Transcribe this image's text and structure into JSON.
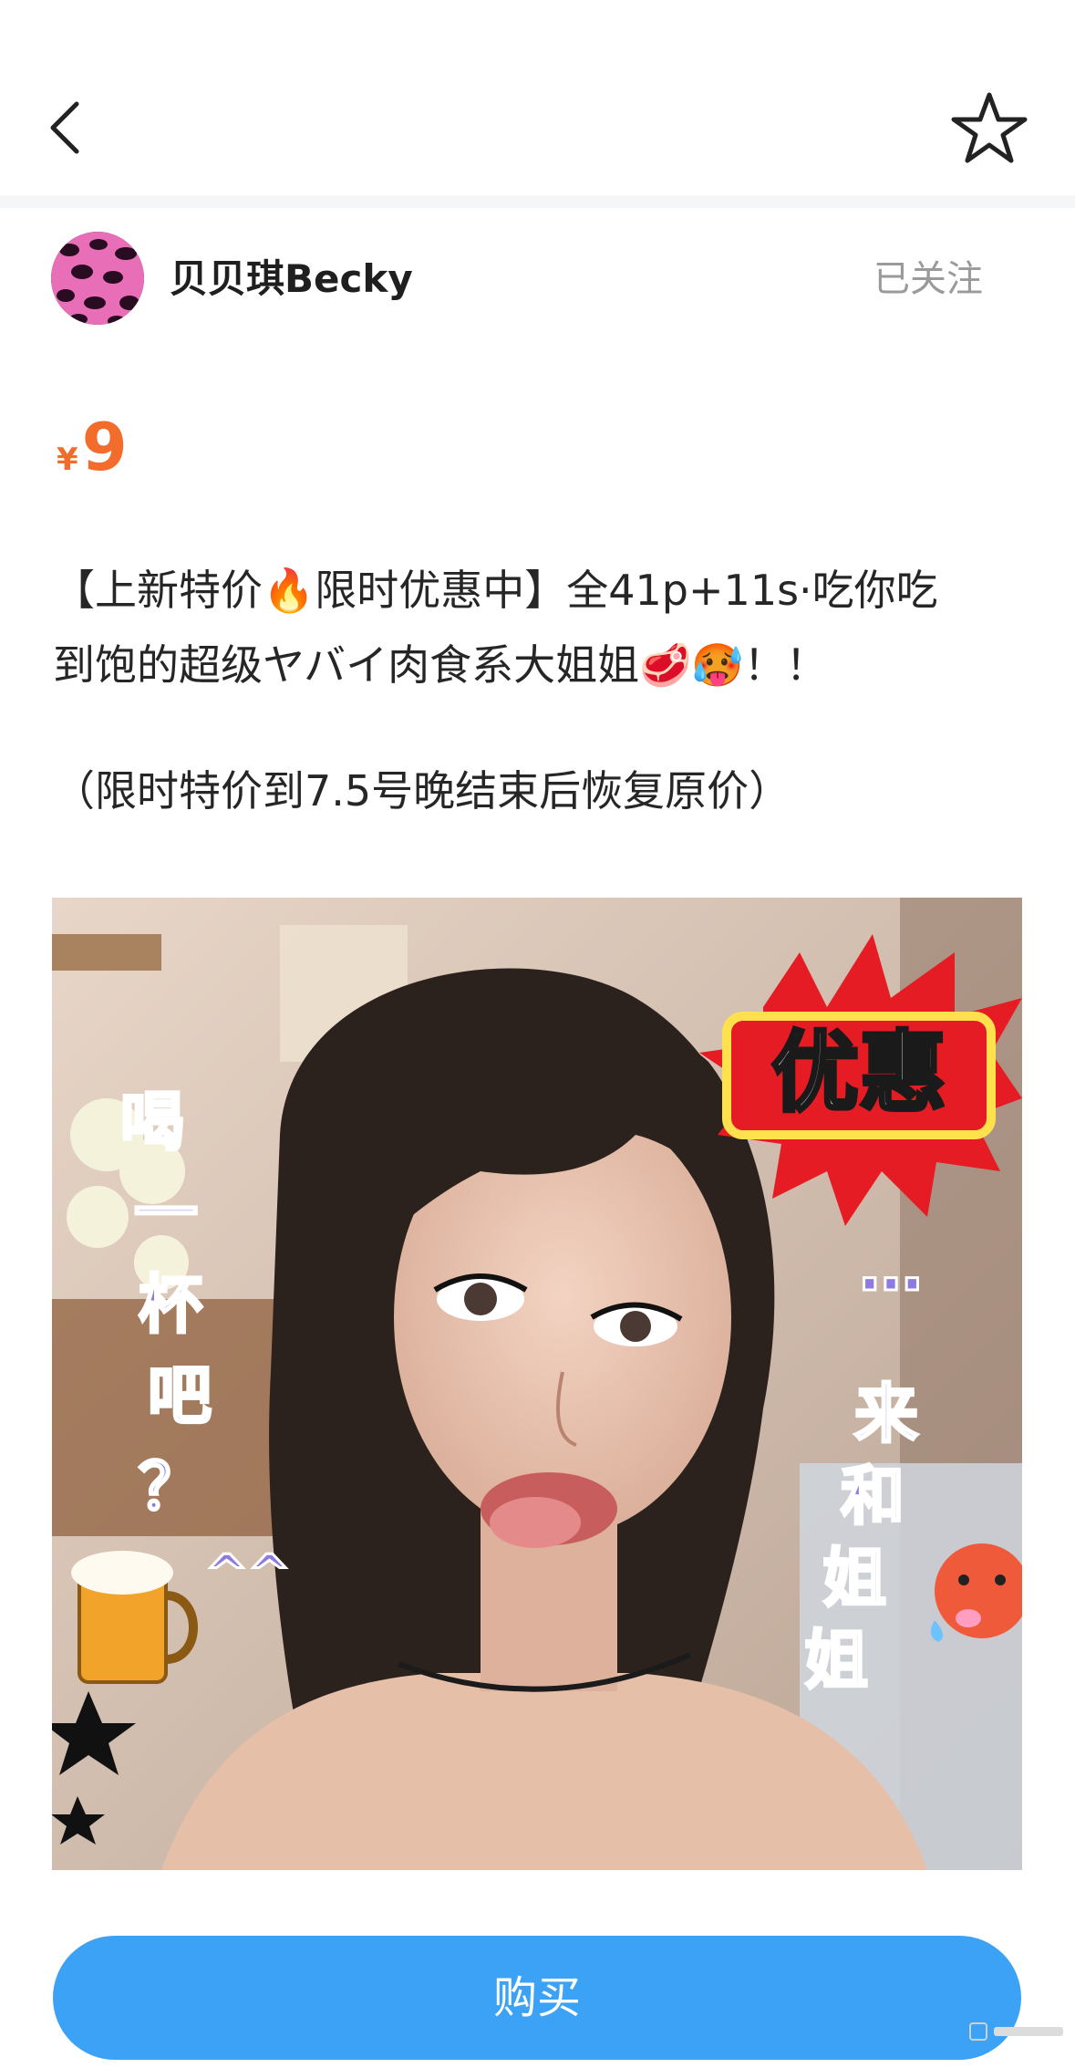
{
  "nav": {
    "back_icon": "chevron-left-icon",
    "favorite_icon": "star-outline-icon"
  },
  "author": {
    "name": "贝贝琪Becky",
    "follow_status": "已关注",
    "avatar_icon": "pink-leopard-avatar"
  },
  "product": {
    "currency": "¥",
    "price": "9",
    "description_line1": "【上新特价🔥限时优惠中】全41p+11s·吃你吃",
    "description_line2": "到饱的超级ヤバイ肉食系大姐姐🥩🥵！！",
    "description_note": "（限时特价到7.5号晚结束后恢复原价）"
  },
  "image": {
    "badge_text": "优惠",
    "left_caption": [
      "喝",
      "一",
      "杯",
      "吧",
      "？",
      "^^"
    ],
    "right_caption": [
      "…",
      "来",
      "和",
      "姐",
      "姐"
    ]
  },
  "actions": {
    "buy_label": "购买"
  },
  "colors": {
    "price": "#f36c2b",
    "buy_button": "#3ba2f6",
    "follow_text": "#9a9a9a"
  }
}
